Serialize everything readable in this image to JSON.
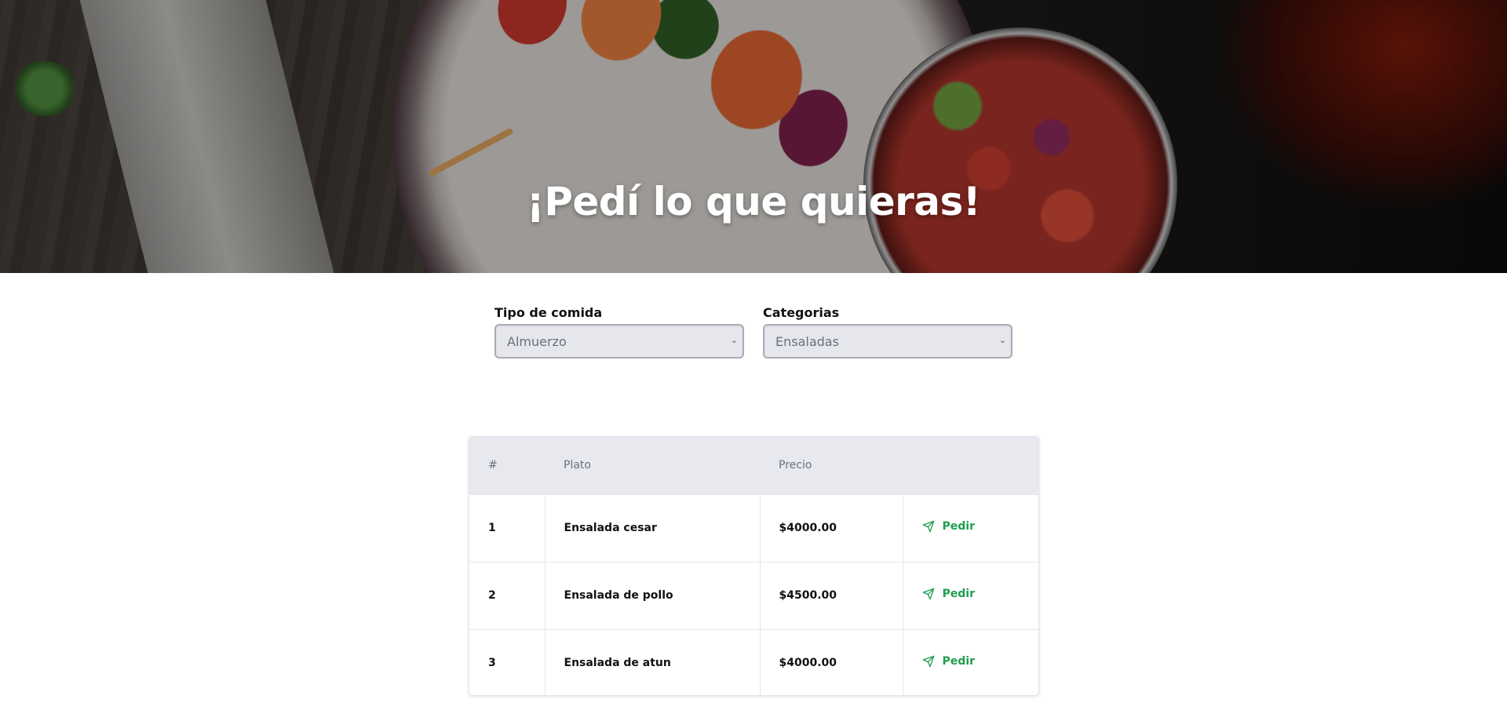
{
  "hero": {
    "title": "¡Pedí lo que quieras!"
  },
  "filters": {
    "tipo": {
      "label": "Tipo de comida",
      "value": "Almuerzo"
    },
    "categorias": {
      "label": "Categorias",
      "value": "Ensaladas"
    }
  },
  "table": {
    "headers": {
      "num": "#",
      "plato": "Plato",
      "precio": "Precio"
    },
    "rows": [
      {
        "num": "1",
        "plato": "Ensalada cesar",
        "precio": "$4000.00",
        "action": "Pedir"
      },
      {
        "num": "2",
        "plato": "Ensalada de pollo",
        "precio": "$4500.00",
        "action": "Pedir"
      },
      {
        "num": "3",
        "plato": "Ensalada de atun",
        "precio": "$4000.00",
        "action": "Pedir"
      }
    ]
  },
  "icons": {
    "action_icon": "send-icon",
    "select_icon": "chevron-down-icon"
  },
  "colors": {
    "action_green": "#1f9d4f",
    "header_bg": "#e8e9ee",
    "select_bg": "#e6e7ec"
  }
}
